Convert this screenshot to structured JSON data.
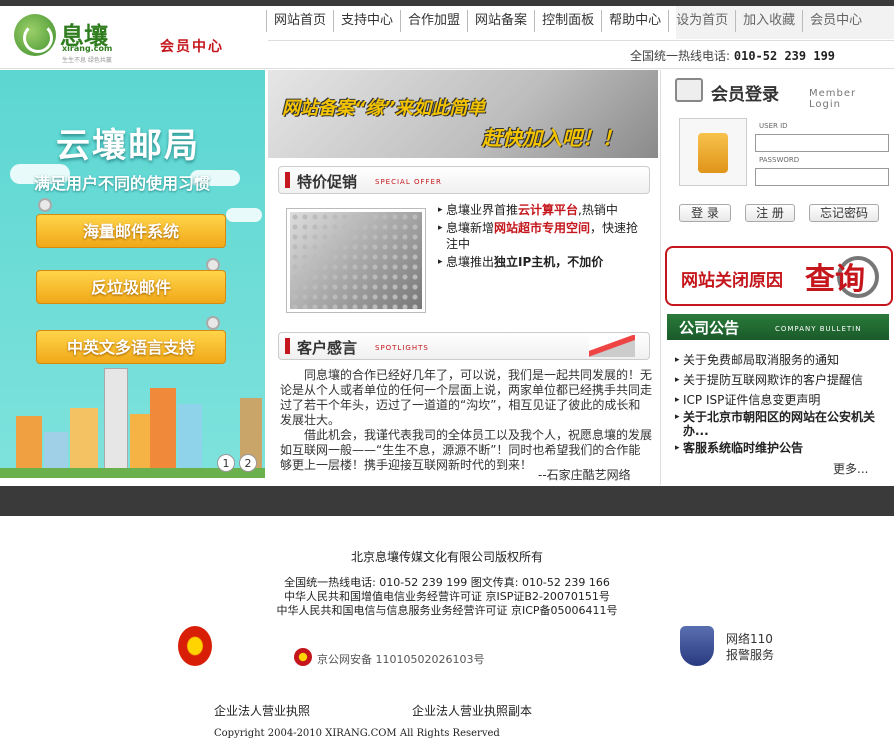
{
  "header": {
    "logo_text": "息壤",
    "logo_sub": "xirang.com",
    "logo_slogan": "生生不息 绿色共赢",
    "member_center": "会员中心",
    "hotline_label": "全国统一热线电话:",
    "hotline_number": "010-52 239 199"
  },
  "nav": {
    "items": [
      "网站首页",
      "支持中心",
      "合作加盟",
      "网站备案",
      "控制面板",
      "帮助中心"
    ],
    "right_items": [
      "设为首页",
      "加入收藏",
      "会员中心"
    ]
  },
  "left_banner": {
    "title": "云壤邮局",
    "subtitle": "满足用户不同的使用习惯",
    "buttons": [
      "海量邮件系统",
      "反垃圾邮件",
      "中英文多语言支持"
    ],
    "pages": [
      "1",
      "2"
    ]
  },
  "mid_banner": {
    "line1": "网站备案“缘”来如此简单",
    "line2": "赶快加入吧！！"
  },
  "special_offer": {
    "title": "特价促销",
    "title_en": "SPECIAL OFFER",
    "items": [
      {
        "pre": "息壤业界首推",
        "hl": "云计算平台",
        "post": ",热销中"
      },
      {
        "pre": "息壤新增",
        "hl": "网站超市专用空间",
        "post": "，快速抢注中"
      },
      {
        "pre": "息壤推出",
        "hl": "独立IP主机",
        "post": "，不加价"
      }
    ]
  },
  "spotlights": {
    "title": "客户感言",
    "title_en": "SPOTLIGHTS",
    "para1": "同息壤的合作已经好几年了，可以说，我们是一起共同发展的！无论是从个人或者单位的任何一个层面上说，两家单位都已经携手共同走过了若干个年头，迈过了一道道的“沟坎”，相互见证了彼此的成长和发展壮大。",
    "para2": "借此机会，我谨代表我司的全体员工以及我个人，祝愿息壤的发展如互联网一般——“生生不息，源源不断”！同时也希望我们的合作能够更上一层楼！携手迎接互联网新时代的到来！",
    "signature": "--石家庄酷艺网络"
  },
  "login": {
    "title": "会员登录",
    "title_en": "Member Login",
    "user_label": "USER ID",
    "pass_label": "PASSWORD",
    "login_btn": "登 录",
    "register_btn": "注 册",
    "forgot_btn": "忘记密码"
  },
  "query_banner": {
    "text": "网站关闭原因",
    "big": "查询"
  },
  "bulletin": {
    "title": "公司公告",
    "title_en": "COMPANY BULLETIN",
    "items": [
      "关于免费邮局取消服务的通知",
      "关于提防互联网欺诈的客户提醒信",
      "ICP ISP证件信息变更声明",
      "关于北京市朝阳区的网站在公安机关办...",
      "客服系统临时维护公告"
    ],
    "more": "更多..."
  },
  "footer": {
    "company": "北京息壤传媒文化有限公司版权所有",
    "contact": "全国统一热线电话: 010-52 239 199 图文传真: 010-52 239 166",
    "license1": "中华人民共和国增值电信业务经营许可证 京ISP证B2-20070151号",
    "license2": "中华人民共和国电信与信息服务业务经营许可证 京ICP备05006411号",
    "police": "京公网安备 11010502026103号",
    "net110_1": "网络110",
    "net110_2": "报警服务",
    "biz_license": "企业法人营业执照",
    "biz_license_copy": "企业法人营业执照副本",
    "copyright": "Copyright 2004-2010 XIRANG.COM All Rights Reserved"
  },
  "colors": {
    "brand_green": "#2f7d1e",
    "accent_red": "#c4161c",
    "banner_teal": "#5cd6d2",
    "bulletin_green": "#1a5a2a"
  }
}
